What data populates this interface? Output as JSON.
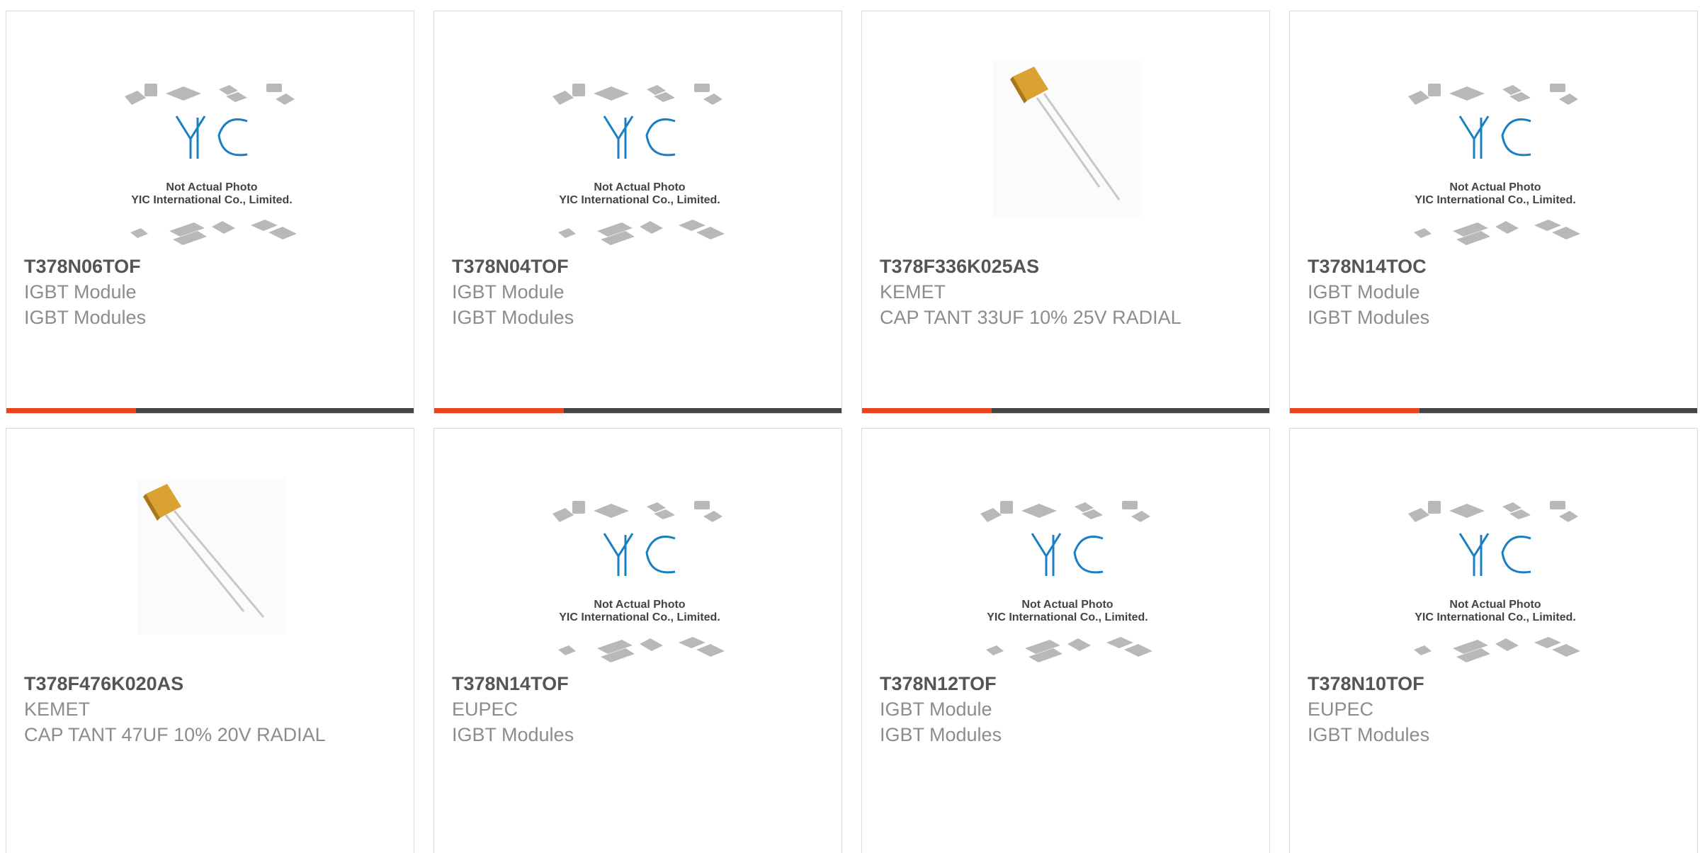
{
  "logo": {
    "brand_text": "YIC",
    "caption_line1": "Not Actual Photo",
    "caption_line2": "YIC International Co., Limited."
  },
  "colors": {
    "accent": "#e8431a",
    "bar_dark": "#444444",
    "logo_blue": "#1a7fc2",
    "chip_gray": "#b5b5b5",
    "capacitor_gold": "#d9a232"
  },
  "products": [
    {
      "part_number": "T378N06TOF",
      "manufacturer": "IGBT Module",
      "description": "IGBT Modules",
      "image": "placeholder-logo"
    },
    {
      "part_number": "T378N04TOF",
      "manufacturer": "IGBT Module",
      "description": "IGBT Modules",
      "image": "placeholder-logo"
    },
    {
      "part_number": "T378F336K025AS",
      "manufacturer": "KEMET",
      "description": "CAP TANT 33UF 10% 25V RADIAL",
      "image": "tantalum-capacitor-photo"
    },
    {
      "part_number": "T378N14TOC",
      "manufacturer": "IGBT Module",
      "description": "IGBT Modules",
      "image": "placeholder-logo"
    },
    {
      "part_number": "T378F476K020AS",
      "manufacturer": "KEMET",
      "description": "CAP TANT 47UF 10% 20V RADIAL",
      "image": "tantalum-capacitor-photo"
    },
    {
      "part_number": "T378N14TOF",
      "manufacturer": "EUPEC",
      "description": "IGBT Modules",
      "image": "placeholder-logo"
    },
    {
      "part_number": "T378N12TOF",
      "manufacturer": "IGBT Module",
      "description": "IGBT Modules",
      "image": "placeholder-logo"
    },
    {
      "part_number": "T378N10TOF",
      "manufacturer": "EUPEC",
      "description": "IGBT Modules",
      "image": "placeholder-logo"
    }
  ]
}
